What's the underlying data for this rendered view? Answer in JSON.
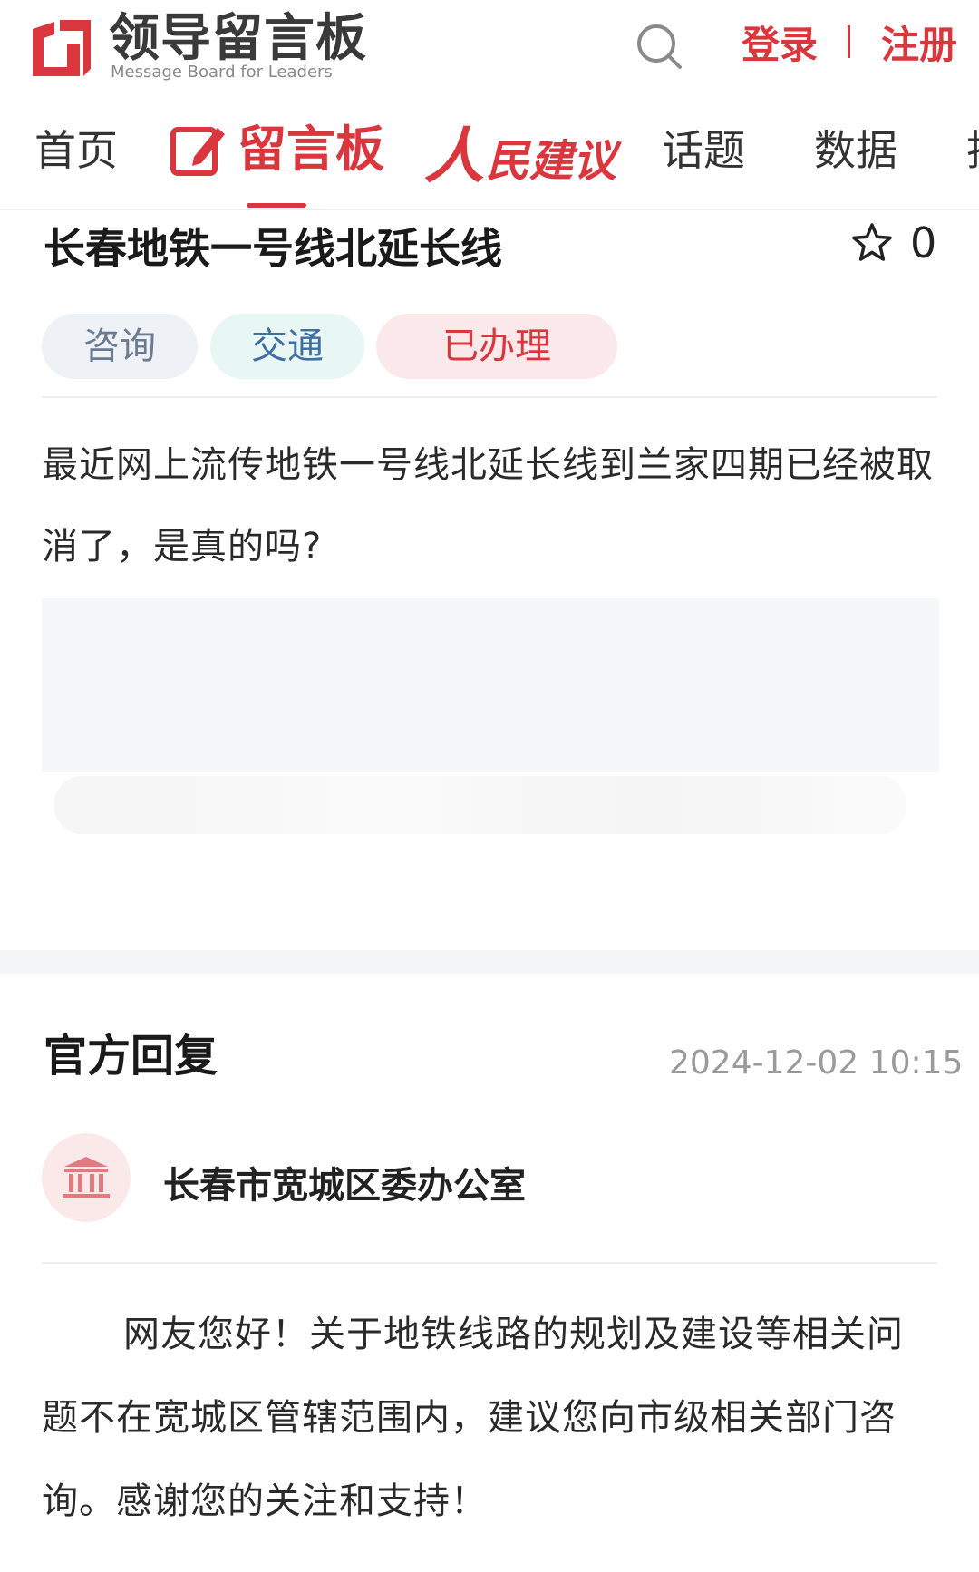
{
  "header": {
    "logo_cn": "领导留言板",
    "logo_en": "Message Board for Leaders",
    "login": "登录",
    "register": "注册",
    "brand_color": "#d9363e",
    "icons": {
      "search": "search-icon",
      "logo": "logo-mark-icon"
    }
  },
  "nav": {
    "items": [
      "首页",
      "留言板",
      "人",
      "民建议",
      "话题",
      "数据",
      "投"
    ],
    "active_index": 1
  },
  "message": {
    "title": "长春地铁一号线北延长线",
    "fav_count": "0",
    "tags": [
      "咨询",
      "交通",
      "已办理"
    ],
    "content": "最近网上流传地铁一号线北延长线到兰家四期已经被取消了，是真的吗?"
  },
  "reply": {
    "heading": "官方回复",
    "time": "2024-12-02 10:15",
    "org": "长春市宽城区委办公室",
    "content": "网友您好！关于地铁线路的规划及建设等相关问题不在宽城区管辖范围内，建议您向市级相关部门咨询。感谢您的关注和支持！"
  }
}
